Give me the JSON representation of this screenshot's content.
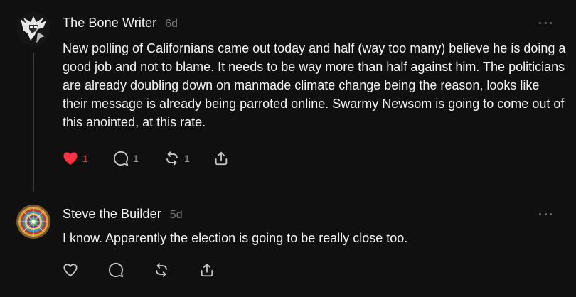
{
  "posts": [
    {
      "author": "The Bone Writer",
      "time": "6d",
      "text": "New polling of Californians came out today and half (way too many) believe he is doing a good job and not to blame. It needs to be way more than half against him. The politicians are already doubling down on manmade climate change being the reason, looks like their message is already being parroted online. Swarmy Newsom is going to come out of this anointed, at this rate.",
      "likes": "1",
      "replies": "1",
      "reposts": "1",
      "liked": true
    },
    {
      "author": "Steve the Builder",
      "time": "5d",
      "text": "I know. Apparently the election is going to be really close too.",
      "liked": false
    }
  ],
  "colors": {
    "background": "#101010",
    "text": "#f3f5f7",
    "muted": "#777777",
    "like_red": "#ff3040"
  },
  "icons": [
    "heart-icon",
    "comment-icon",
    "repost-icon",
    "share-icon",
    "more-icon"
  ]
}
